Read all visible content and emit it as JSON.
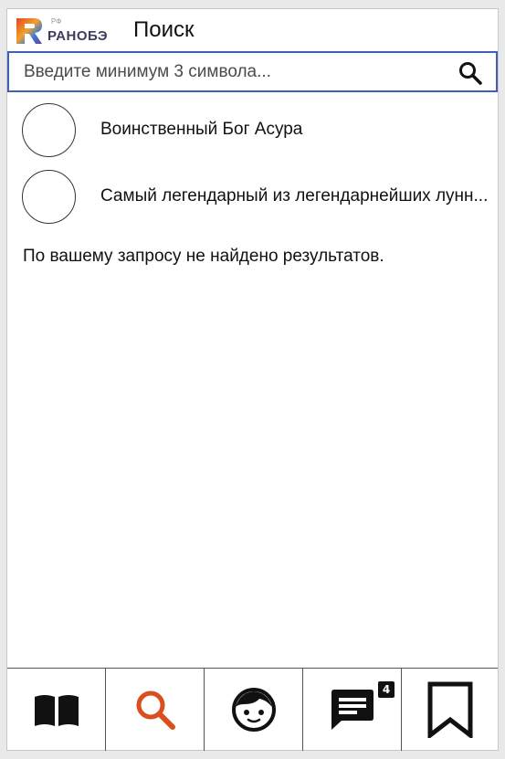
{
  "header": {
    "logo_text": "РАНОБЭ",
    "logo_superscript": "РФ",
    "title": "Поиск"
  },
  "search": {
    "placeholder": "Введите минимум 3 символа...",
    "value": "",
    "icon": "search-icon"
  },
  "results": [
    {
      "title": "Воинственный Бог Асура"
    },
    {
      "title": "Самый легендарный из легендарнейших лунн..."
    }
  ],
  "empty_message": "По вашему запросу не найдено результатов.",
  "bottom_nav": {
    "items": [
      {
        "icon": "book-icon"
      },
      {
        "icon": "search-icon",
        "active": true
      },
      {
        "icon": "face-icon"
      },
      {
        "icon": "chat-icon",
        "badge": "4"
      },
      {
        "icon": "bookmark-icon"
      }
    ]
  },
  "colors": {
    "active_accent": "#d94f1d",
    "search_border": "#3f5fbf",
    "logo_gradient": [
      "#e8442a",
      "#f2a22a",
      "#3a7bd5",
      "#6a3fa0"
    ]
  }
}
